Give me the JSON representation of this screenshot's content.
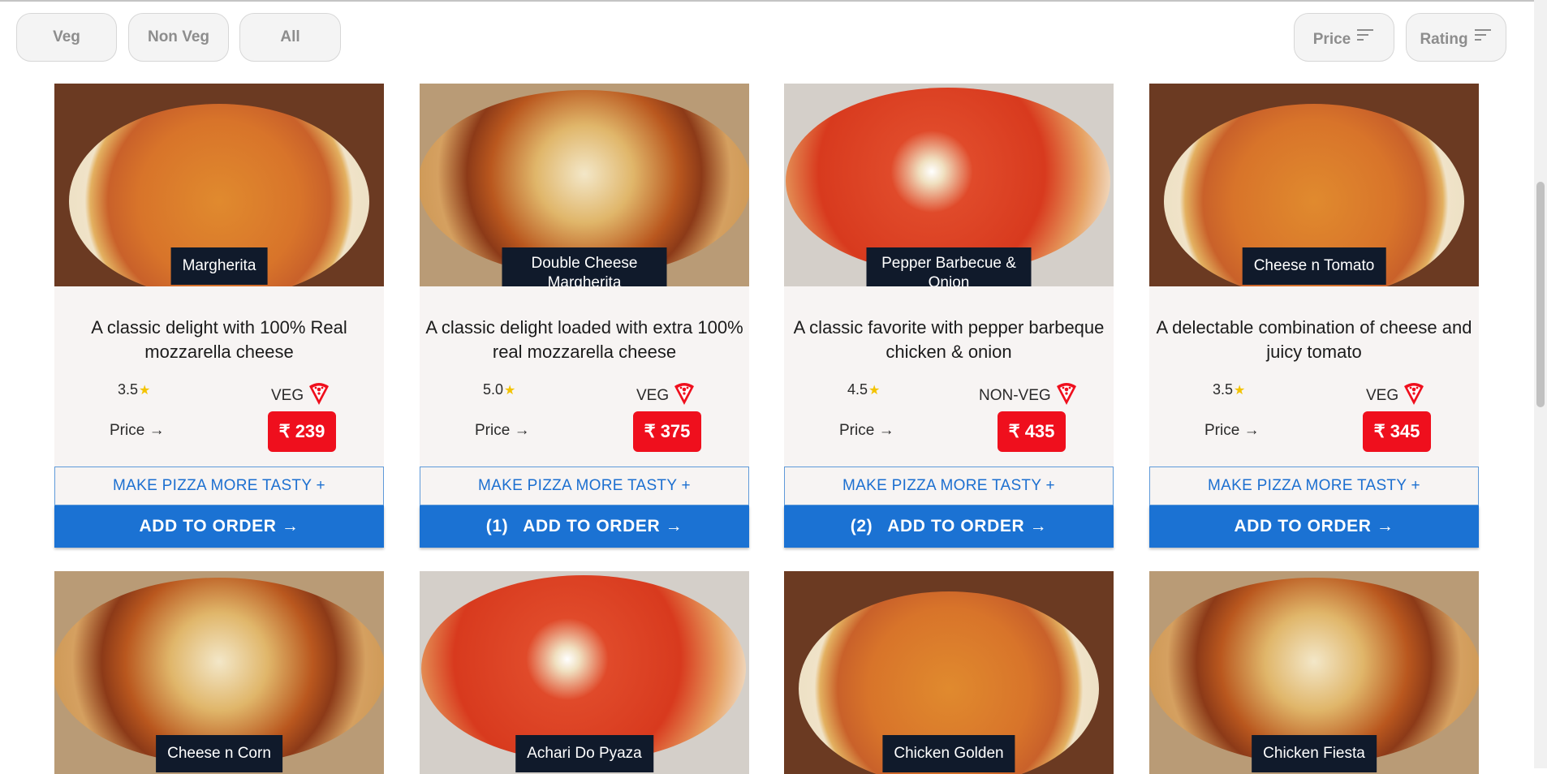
{
  "filters": {
    "veg": "Veg",
    "non_veg": "Non Veg",
    "all": "All"
  },
  "sort": {
    "price": "Price",
    "rating": "Rating"
  },
  "cards": [
    {
      "name": "Margherita",
      "description": "A classic delight with 100% Real mozzarella cheese",
      "rating": "3.5",
      "type": "VEG",
      "price_label": "Price →",
      "price": "₹ 239",
      "tasty_label": "MAKE PIZZA MORE TASTY +",
      "order_label": "ADD TO ORDER →",
      "order_count": ""
    },
    {
      "name": "Double Cheese Margherita",
      "description": "A classic delight loaded with extra 100% real mozzarella cheese",
      "rating": "5.0",
      "type": "VEG",
      "price_label": "Price →",
      "price": "₹ 375",
      "tasty_label": "MAKE PIZZA MORE TASTY +",
      "order_label": "ADD TO ORDER →",
      "order_count": "(1)"
    },
    {
      "name": "Pepper Barbecue & Onion",
      "description": "A classic favorite with pepper barbeque chicken & onion",
      "rating": "4.5",
      "type": "NON-VEG",
      "price_label": "Price →",
      "price": "₹ 435",
      "tasty_label": "MAKE PIZZA MORE TASTY +",
      "order_label": "ADD TO ORDER →",
      "order_count": "(2)"
    },
    {
      "name": "Cheese n Tomato",
      "description": "A delectable combination of cheese and juicy tomato",
      "rating": "3.5",
      "type": "VEG",
      "price_label": "Price →",
      "price": "₹ 345",
      "tasty_label": "MAKE PIZZA MORE TASTY +",
      "order_label": "ADD TO ORDER →",
      "order_count": ""
    },
    {
      "name": "Cheese n Corn"
    },
    {
      "name": "Achari Do Pyaza"
    },
    {
      "name": "Chicken Golden"
    },
    {
      "name": "Chicken Fiesta"
    }
  ],
  "star_glyph": "★"
}
